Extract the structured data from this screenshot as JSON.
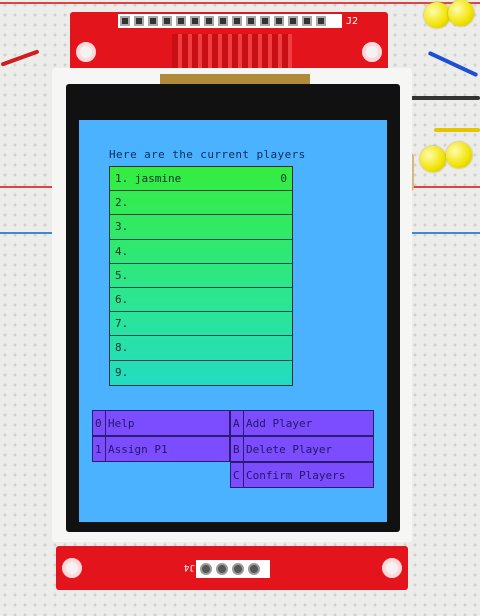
{
  "screen": {
    "title": "Here are the current players",
    "players": [
      {
        "label": "1. jasmine",
        "score": "0"
      },
      {
        "label": "2.",
        "score": ""
      },
      {
        "label": "3.",
        "score": ""
      },
      {
        "label": "4.",
        "score": ""
      },
      {
        "label": "5.",
        "score": ""
      },
      {
        "label": "6.",
        "score": ""
      },
      {
        "label": "7.",
        "score": ""
      },
      {
        "label": "8.",
        "score": ""
      },
      {
        "label": "9.",
        "score": ""
      }
    ],
    "menu": [
      {
        "key": "0",
        "label": "Help"
      },
      {
        "key": "1",
        "label": "Assign P1"
      },
      {
        "key": "A",
        "label": "Add Player"
      },
      {
        "key": "B",
        "label": "Delete Player"
      },
      {
        "key": "C",
        "label": "Confirm Players"
      }
    ]
  },
  "board": {
    "top_connector_label": "J2",
    "bottom_connector_label": "J4"
  },
  "colors": {
    "screen_bg": "#4ab2ff",
    "player_list_top": "#34ed3f",
    "player_list_bottom": "#23dcc1",
    "menu_button": "#7c4dff",
    "pcb": "#e3141b"
  }
}
